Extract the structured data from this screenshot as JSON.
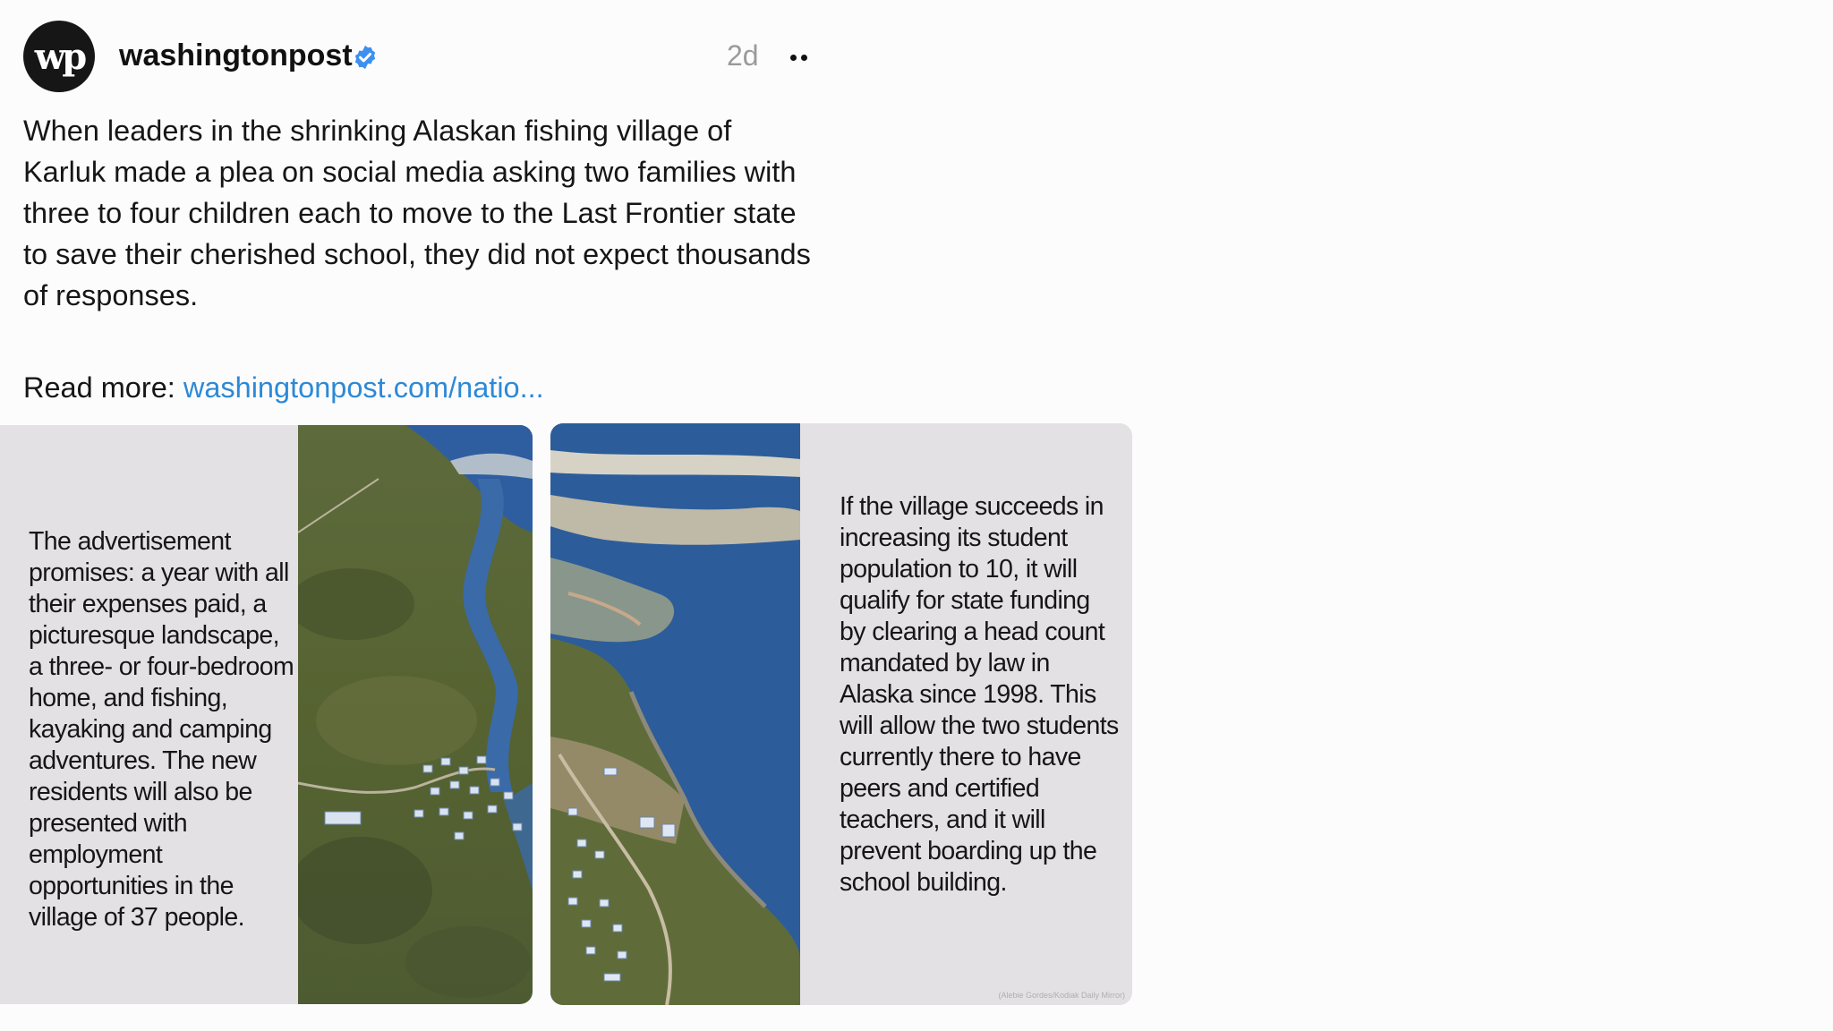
{
  "post": {
    "author": {
      "avatar_text": "wp",
      "username": "washingtonpost",
      "verified_icon": "verified-badge-icon"
    },
    "timestamp": "2d",
    "more_icon": "more-options-icon",
    "caption": "When leaders in the shrinking Alaskan fishing village of Karluk made a plea on social media asking two families with three to four children each to move to the Last Frontier state to save their cherished school, they did not expect thousands of responses.",
    "read_more_label": "Read more:",
    "read_more_link": "washingtonpost.com/natio..."
  },
  "carousel": {
    "slides": [
      {
        "text": "The advertisement promises: a year with all their expenses paid, a picturesque landscape, a three- or four-bedroom home, and fishing, kayaking and camping adventures. The new residents will also be presented with employment opportunities in the village of 37 people."
      },
      {
        "text": "If the village succeeds in increasing its student population to 10, it will qualify for state funding by clearing a head count mandated by law in Alaska since 1998. This will allow the two students currently there to have peers and certified teachers, and it will prevent boarding up the school building.",
        "credit": "(Alebie Gordes/Kodiak Daily Mirror)"
      }
    ]
  },
  "colors": {
    "link": "#2d89d6",
    "verified": "#3d8ff0",
    "slide_bg": "#e3e1e3"
  }
}
